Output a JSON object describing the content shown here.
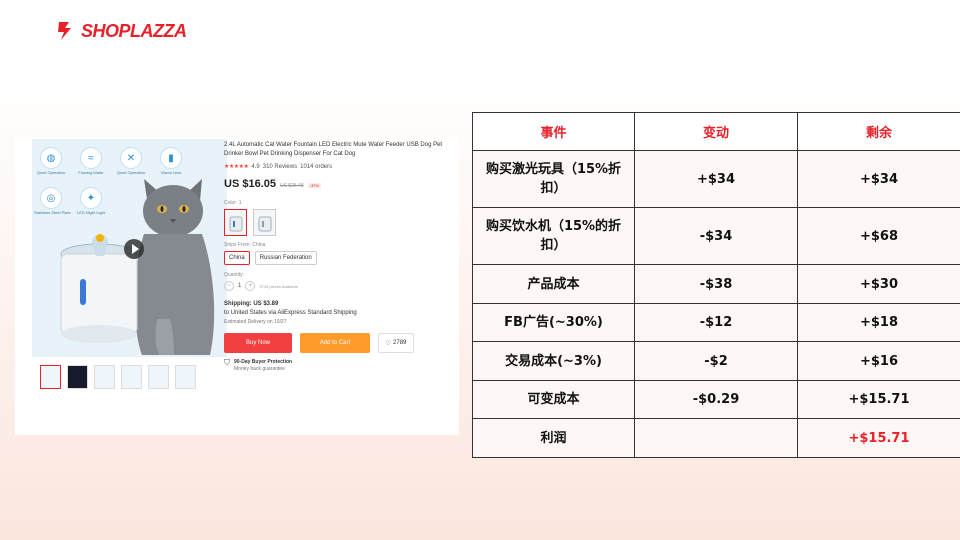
{
  "brand": {
    "name": "SHOPLAZZA",
    "color": "#e8202a"
  },
  "product": {
    "features": [
      "Quiet Operation",
      "Flowing Water",
      "Quiet Operation",
      "Visual Lens",
      "Stainless Steel Plate",
      "LED Night Light"
    ],
    "title": "2.4L Automatic Cat Water Fountain LED Electric Mute Water Feeder USB Dog Pet Drinker Bowl Pet Drinking Dispenser For Cat Dog",
    "rating": "4.9",
    "reviews": "310 Reviews",
    "orders": "1014 orders",
    "price": "US $16.05",
    "old_price": "US $25.48",
    "discount": "-37%",
    "color_label": "Color: 1",
    "ships_from_label": "Ships From: China",
    "ship_options": [
      "China",
      "Russian Federation"
    ],
    "quantity_label": "Quantity:",
    "quantity": "1",
    "quantity_note": "9734 pieces available",
    "shipping": "Shipping: US $3.89",
    "shipping_dest": "to United States via AliExpress Standard Shipping",
    "delivery": "Estimated Delivery on 10/27",
    "buy_now": "Buy Now",
    "add_to_cart": "Add to Cart",
    "wishlist_count": "2789",
    "protection_title": "90-Day Buyer Protection",
    "protection_sub": "Money back guarantee"
  },
  "table": {
    "headers": [
      "事件",
      "变动",
      "剩余"
    ],
    "rows": [
      {
        "event": "购买激光玩具（15%折扣）",
        "change": "+$34",
        "remaining": "+$34"
      },
      {
        "event": "购买饮水机（15%的折扣）",
        "change": "-$34",
        "remaining": "+$68"
      },
      {
        "event": "产品成本",
        "change": "-$38",
        "remaining": "+$30"
      },
      {
        "event": "FB广告(~30%)",
        "change": "-$12",
        "remaining": "+$18"
      },
      {
        "event": "交易成本(~3%)",
        "change": "-$2",
        "remaining": "+$16"
      },
      {
        "event": "可变成本",
        "change": "-$0.29",
        "remaining": "+$15.71"
      },
      {
        "event": "利润",
        "change": "",
        "remaining": "+$15.71"
      }
    ]
  }
}
